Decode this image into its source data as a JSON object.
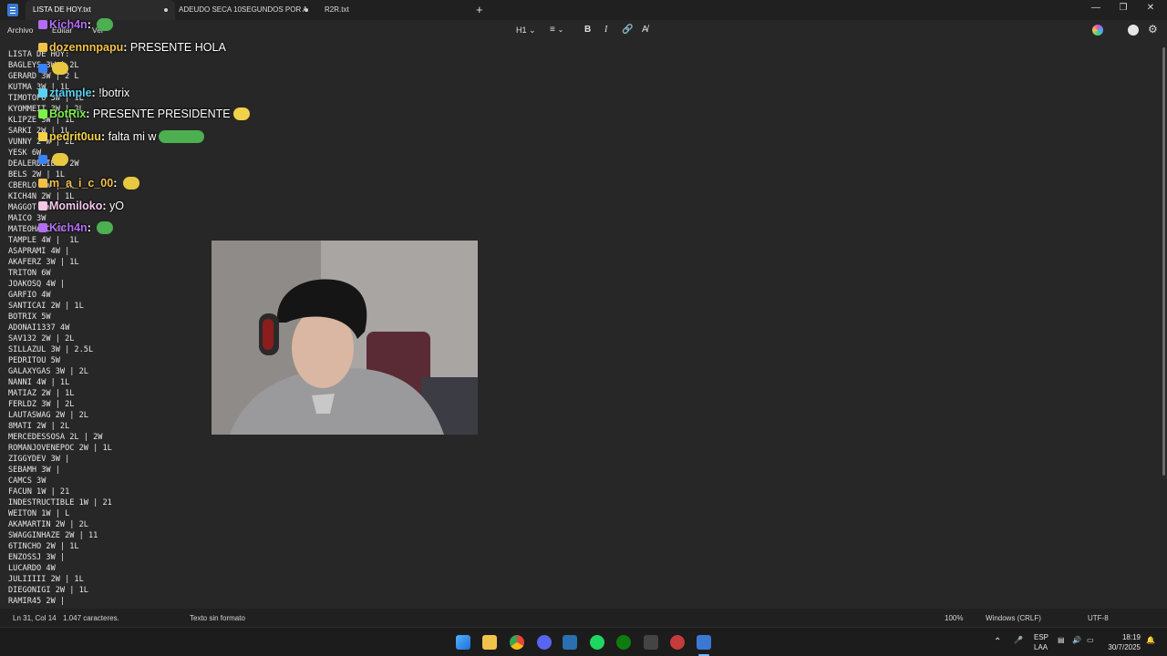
{
  "tabs": [
    {
      "label": "LISTA DE HOY.txt",
      "modified": true
    },
    {
      "label": "ADEUDO SECA 10SEGUNDOS POR A",
      "modified": true
    },
    {
      "label": "R2R.txt",
      "modified": false
    }
  ],
  "menu": [
    "Archivo",
    "Editar",
    "Ver"
  ],
  "toolbar": {
    "heading": "H1",
    "bold": "B",
    "italic": "I"
  },
  "document": {
    "lines": [
      "LISTA DE HOY:",
      "BAGLEYS 3W | 2L",
      "GERARD 3W | 2 L",
      "KUTMA 3W | 1L",
      "TIMOTOPO 3W | 1L",
      "KYOMMEIT 3W | 2L",
      "KLIPZE 3W | 1L",
      "SARKI 2W | 1L",
      "VUNNY 2 W | 2L",
      "YESK 6W",
      "DEALERDEIBAL 2W",
      "BELS 2W | 1L",
      "CBERLO 1W | 1L",
      "KICH4N 2W | 1L",
      "MAGGOT 1W",
      "MAICO 3W",
      "MATEOHARC 4W",
      "TAMPLE 4W |  1L",
      "ASAPRAMI 4W |",
      "AKAFERZ 3W | 1L",
      "TRITON 6W",
      "JOAKOSQ 4W |",
      "GARFIO 4W",
      "SANTICAI 2W | 1L",
      "BOTRIX 5W",
      "ADONAI1337 4W",
      "SAV132 2W | 2L",
      "SILLAZUL 3W | 2.5L",
      "PEDRITOU 5W",
      "GALAXYGAS 3W | 2L",
      "NANNI 4W | 1L",
      "MATIAZ 2W | 1L",
      "FERLDZ 3W | 2L",
      "LAUTASWAG 2W | 2L",
      "8MATI 2W | 2L",
      "MERCEDESSOSA 2L | 2W",
      "ROMANJOVENEPOC 2W | 1L",
      "ZIGGYDEV 3W |",
      "SEBAMH 3W |",
      "CAMCS 3W",
      "FACUN 1W | 21",
      "INDESTRUCTIBLE 1W | 21",
      "WEITON 1W | L",
      "AKAMARTIN 2W | 2L",
      "SWAGGINHAZE 2W | 11",
      "6TINCHO 2W | 1L",
      "ENZOSSJ 3W |",
      "LUCARDO 4W",
      "JULIIIII 2W | 1L",
      "DIEGONIGI 2W | 1L",
      "RAMIR45 2W |"
    ]
  },
  "chat": [
    {
      "user": "Kich4n",
      "message": "",
      "color": "#b46cf5",
      "emote": "pepe"
    },
    {
      "user": "dozennnpapu",
      "message": "PRESENTE HOLA",
      "color": "#f2c14a"
    },
    {
      "user": "",
      "message": "",
      "color": "#3b82f6",
      "emote": "corn"
    },
    {
      "user": "ztample",
      "message": "!botrix",
      "color": "#5ad1f0"
    },
    {
      "user": "BotRix",
      "message": "PRESENTE PRESIDENTE",
      "color": "#7ef04a",
      "emote": "face"
    },
    {
      "user": "pedrit0uu",
      "message": "falta mi w",
      "color": "#f2d14a",
      "emote": "pepe-wide"
    },
    {
      "user": "",
      "message": "",
      "color": "#3b82f6",
      "emote": "corn"
    },
    {
      "user": "m_a_i_c_00",
      "message": "",
      "color": "#f2c14a",
      "emote": "corn"
    },
    {
      "user": "Momiloko",
      "message": "yO",
      "color": "#f5c6e8"
    },
    {
      "user": "Kich4n",
      "message": "",
      "color": "#b46cf5",
      "emote": "pepe"
    }
  ],
  "statusbar": {
    "position": "Ln 31, Col 14",
    "chars": "1.047 caracteres.",
    "format": "Texto sin formato",
    "zoom": "100%",
    "line_ending": "Windows (CRLF)",
    "encoding": "UTF-8"
  },
  "tray": {
    "lang_top": "ESP",
    "lang_bottom": "LAA",
    "time": "18:19",
    "date": "30/7/2025"
  }
}
